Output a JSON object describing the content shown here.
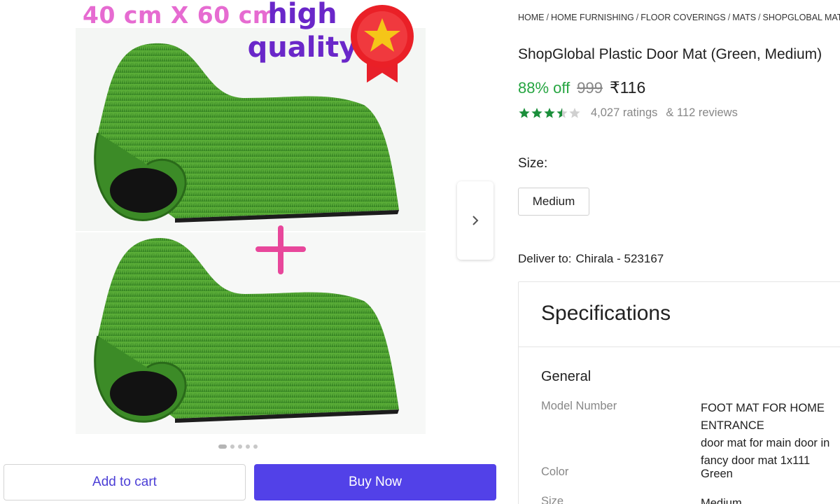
{
  "gallery": {
    "promo_size_text": "40 cm X 60 cm",
    "promo_quality_text": "high quality",
    "image_count": 5,
    "active_image_index": 0
  },
  "actions": {
    "add_to_cart_label": "Add to cart",
    "buy_now_label": "Buy Now"
  },
  "breadcrumb": [
    "HOME",
    "HOME FURNISHING",
    "FLOOR COVERINGS",
    "MATS",
    "SHOPGLOBAL MATS"
  ],
  "product": {
    "title": "ShopGlobal Plastic Door Mat (Green, Medium)",
    "discount": "88% off",
    "mrp": "999",
    "price": "₹116",
    "rating_value": 3.5,
    "ratings_text": "4,027 ratings",
    "reviews_text": "& 112 reviews"
  },
  "size": {
    "label": "Size:",
    "selected": "Medium"
  },
  "delivery": {
    "label": "Deliver to:",
    "location": "Chirala - 523167"
  },
  "specifications": {
    "heading": "Specifications",
    "group": "General",
    "rows": [
      {
        "key": "Model Number",
        "value": "FOOT MAT FOR HOME ENTRANCE\ndoor mat for main door in\nfancy door mat 1x111"
      },
      {
        "key": "Color",
        "value": "Green"
      },
      {
        "key": "Size",
        "value": "Medium"
      }
    ]
  },
  "colors": {
    "accent": "#5241e8",
    "discount_green": "#26a541",
    "star_green": "#1a8f3a",
    "grass_green": "#3f9a2a"
  },
  "icons": [
    "chevron-right-icon",
    "star-badge-icon",
    "plus-icon",
    "star-icon"
  ]
}
